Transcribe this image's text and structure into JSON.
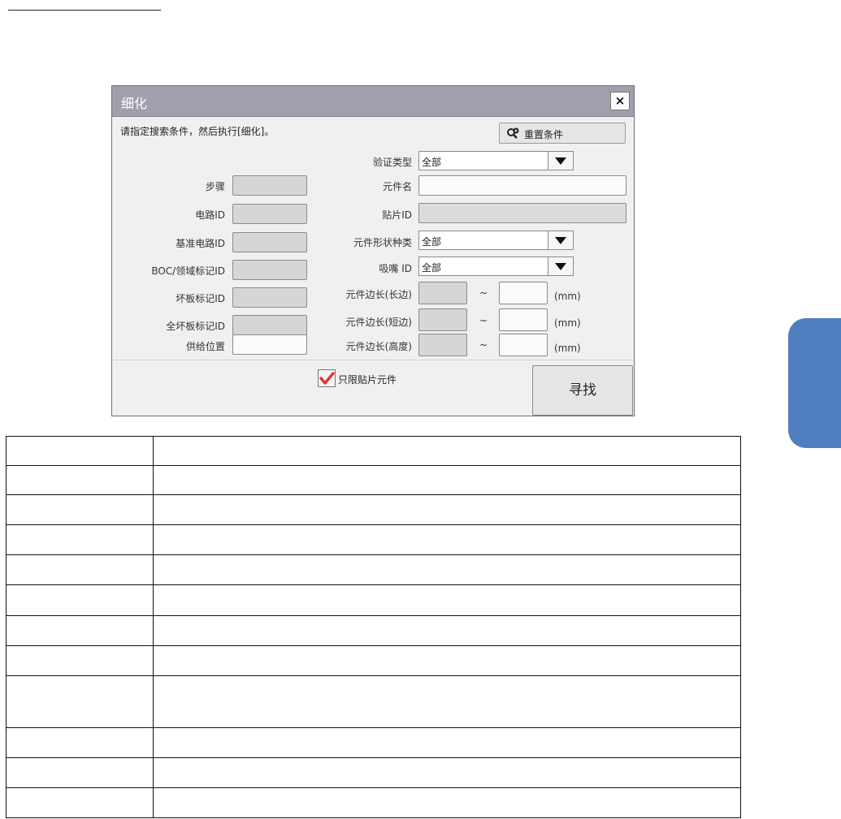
{
  "dialog": {
    "title": "细化",
    "close_label": "×",
    "instruction": "请指定搜索条件，然后执行[细化]。",
    "reset_button_label": "重置条件",
    "left_fields": [
      {
        "label": "步骤"
      },
      {
        "label": "电路ID"
      },
      {
        "label": "基准电路ID"
      },
      {
        "label": "BOC/领域标记ID"
      },
      {
        "label": "坏板标记ID"
      },
      {
        "label": "全坏板标记ID"
      },
      {
        "label": "供给位置"
      }
    ],
    "verification_type": {
      "label": "验证类型",
      "value": "全部"
    },
    "component_name": {
      "label": "元件名"
    },
    "placement_id": {
      "label": "贴片ID"
    },
    "shape_type": {
      "label": "元件形状种类",
      "value": "全部"
    },
    "nozzle_id": {
      "label": "吸嘴 ID",
      "value": "全部"
    },
    "ranges": [
      {
        "label": "元件边长(长边)",
        "sep": "~",
        "unit": "(mm)"
      },
      {
        "label": "元件边长(短边)",
        "sep": "~",
        "unit": "(mm)"
      },
      {
        "label": "元件边长(高度)",
        "sep": "~",
        "unit": "(mm)"
      }
    ],
    "checkbox": {
      "label": "只限贴片元件",
      "checked": true
    },
    "find_button_label": "寻找"
  },
  "colors": {
    "side_tab": "#4f7fbf",
    "titlebar": "#a0a0ac",
    "check": "#e8322d"
  }
}
